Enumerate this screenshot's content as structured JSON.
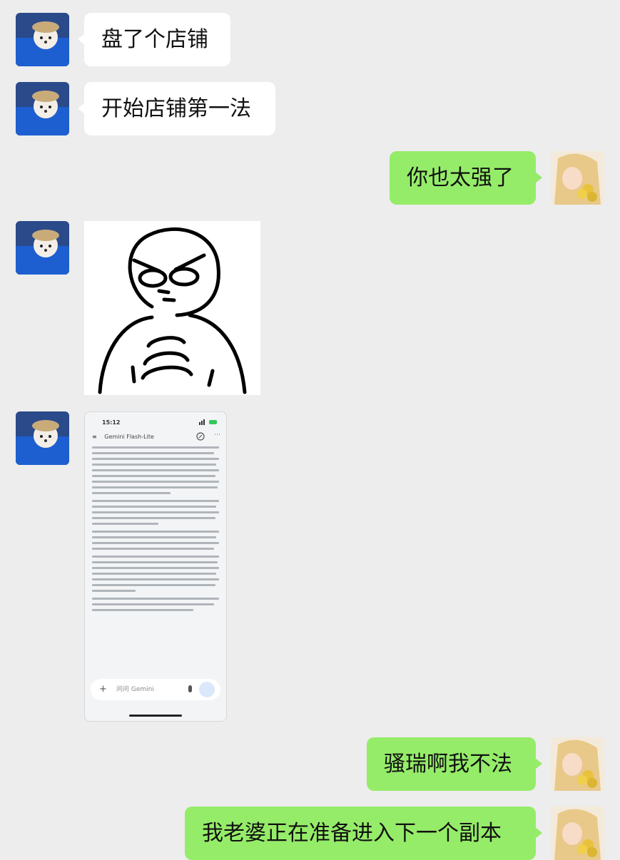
{
  "messages": [
    {
      "side": "left",
      "type": "text",
      "text": "盘了个店铺"
    },
    {
      "side": "left",
      "type": "text",
      "text": "开始店铺第一法"
    },
    {
      "side": "right",
      "type": "text",
      "text": "你也太强了"
    },
    {
      "side": "left",
      "type": "sticker",
      "icon": "determined-face-sticker"
    },
    {
      "side": "left",
      "type": "screenshot"
    },
    {
      "side": "right",
      "type": "text",
      "text": "骚瑞啊我不法"
    },
    {
      "side": "right",
      "type": "text",
      "text": "我老婆正在准备进入下一个副本"
    }
  ],
  "shot": {
    "time": "15:12",
    "app_title": "Gemini Flash-Lite",
    "input_placeholder": "问问 Gemini"
  },
  "colors": {
    "background": "#ededed",
    "incoming_bubble": "#ffffff",
    "outgoing_bubble": "#95ec69"
  }
}
